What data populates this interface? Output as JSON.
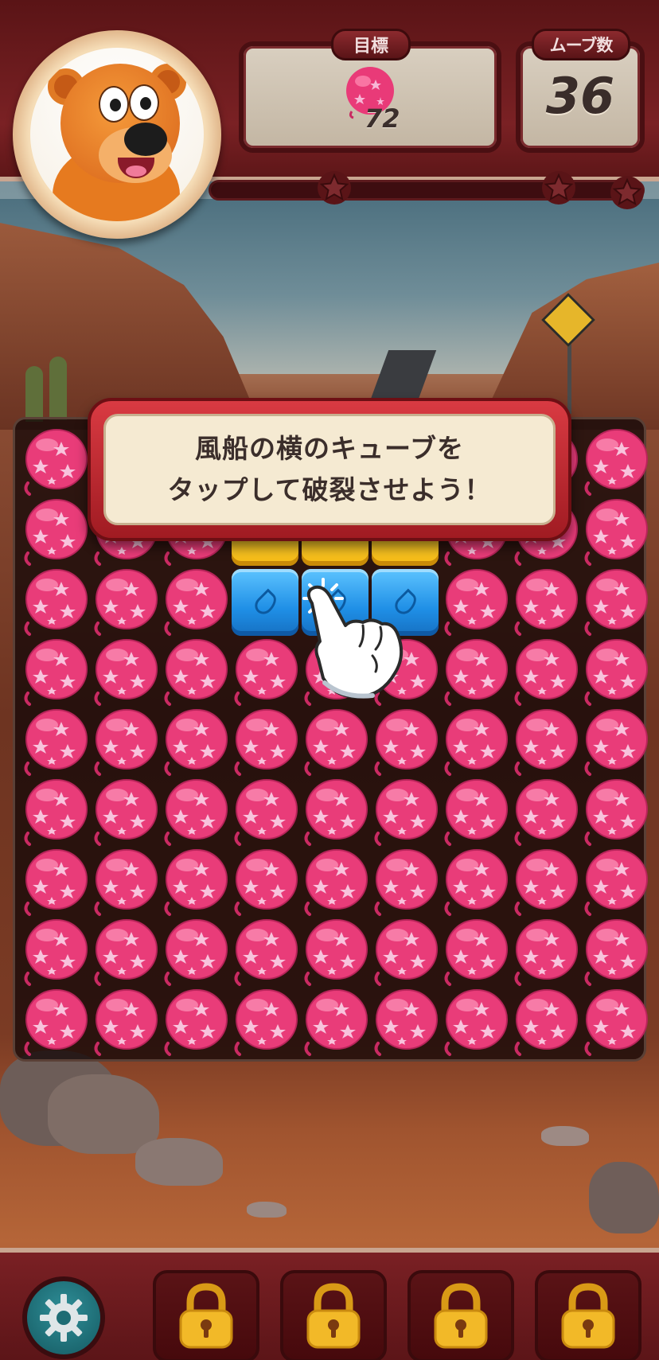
{
  "header": {
    "goal_label": "目標",
    "goal_count": "72",
    "goal_icon": "pink-star-balloon",
    "moves_label": "ムーブ数",
    "moves_count": "36",
    "progress_fraction": 0.0,
    "progress_stars": 3
  },
  "tutorial": {
    "line1": "風船の横のキューブを",
    "line2": "タップして破裂させよう！"
  },
  "board": {
    "cols": 9,
    "rows": 9,
    "grid": [
      "BBBBBBBBB",
      "BBBYYYBBB",
      "BBBCCCBBB",
      "BBBBBBBBB",
      "BBBBBBBBB",
      "BBBBBBBBB",
      "BBBBBBBBB",
      "BBBBBBBBB",
      "BBBBBBBBB"
    ],
    "legend": {
      "B": "pink-star-balloon",
      "Y": "yellow-cube",
      "C": "blue-cube"
    }
  },
  "bottom_bar": {
    "settings_icon": "gear-icon",
    "booster_slots": [
      "locked",
      "locked",
      "locked",
      "locked"
    ],
    "lock_icon": "padlock-icon"
  },
  "colors": {
    "frame": "#7a2124",
    "balloon": "#f0457f",
    "cube_blue": "#1f8fe6",
    "cube_yellow": "#f5c51a",
    "lock_gold": "#f0b82a"
  }
}
